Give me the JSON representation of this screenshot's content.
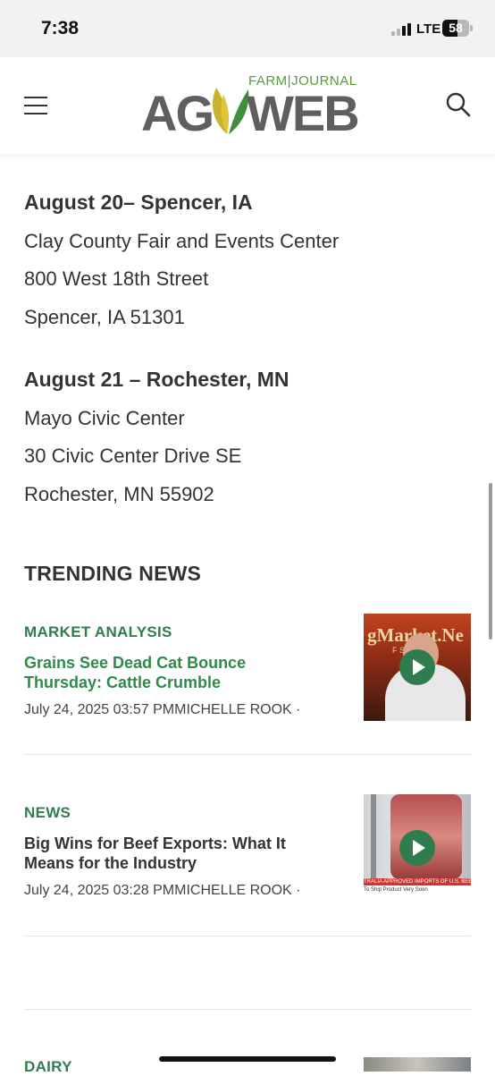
{
  "status": {
    "time": "7:38",
    "network": "LTE",
    "battery": "58",
    "battery_level": 0.58
  },
  "header": {
    "logo_farm_journal": "FARM|JOURNAL",
    "logo_ag": "AG",
    "logo_web": "WEB"
  },
  "events": [
    {
      "title": "August 20– Spencer, IA",
      "venue": "Clay County Fair and Events Center",
      "street": "800 West 18th Street",
      "city": "Spencer, IA 51301"
    },
    {
      "title": "August 21 – Rochester, MN",
      "venue": "Mayo Civic Center",
      "street": "30 Civic Center Drive SE",
      "city": "Rochester, MN 55902"
    }
  ],
  "trending": {
    "heading": "TRENDING NEWS",
    "items": [
      {
        "category": "MARKET ANALYSIS",
        "title": "Grains See Dead Cat Bounce Thursday: Cattle Crumble",
        "meta": "July 24, 2025 03:57 PMMICHELLE ROOK  ·",
        "thumb_text": "gMarket.Ne",
        "thumb_sub": "F   SION OF"
      },
      {
        "category": "NEWS",
        "title": "Big Wins for Beef Exports: What It Means for the Industry",
        "meta": "July 24, 2025 03:28 PMMICHELLE ROOK  ·",
        "thumb_caption": "TRALIA APPROVED IMPORTS OF U.S. BEEF OF AL",
        "thumb_caption2": "To Ship Product Very Soon"
      },
      {
        "category": "DAIRY"
      }
    ]
  }
}
